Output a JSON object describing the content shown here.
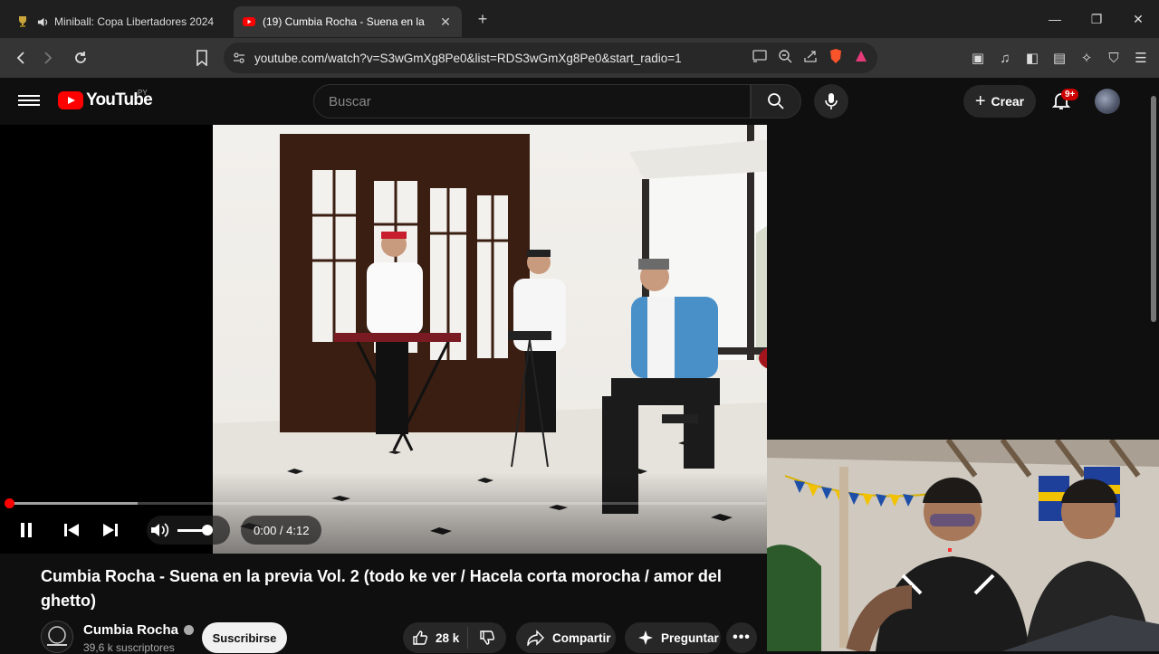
{
  "browser": {
    "tabs": [
      {
        "title": "Miniball: Copa Libertadores 2024",
        "active": false
      },
      {
        "title": "(19) Cumbia Rocha - Suena en la",
        "active": true
      }
    ],
    "new_tab": "+",
    "url": "youtube.com/watch?v=S3wGmXg8Pe0&list=RDS3wGmXg8Pe0&start_radio=1"
  },
  "youtube": {
    "logo_text": "YouTube",
    "country_code": "PY",
    "search_placeholder": "Buscar",
    "create_label": "Crear",
    "notif_badge": "9+"
  },
  "player": {
    "time": "0:00 / 4:12",
    "progress_played": 0.0,
    "progress_loaded": 0.17,
    "volume_level": 0.75
  },
  "video": {
    "title": "Cumbia Rocha - Suena en la previa Vol. 2 (todo ke ver / Hacela corta morocha / amor del ghetto)",
    "channel": "Cumbia Rocha",
    "subscribers": "39,6 k suscriptores",
    "subscribe_label": "Suscribirse",
    "likes": "28 k",
    "share_label": "Compartir",
    "ask_label": "Preguntar"
  },
  "colors": {
    "accent": "#ff0000",
    "background": "#0f0f0f",
    "chrome": "#353535"
  }
}
